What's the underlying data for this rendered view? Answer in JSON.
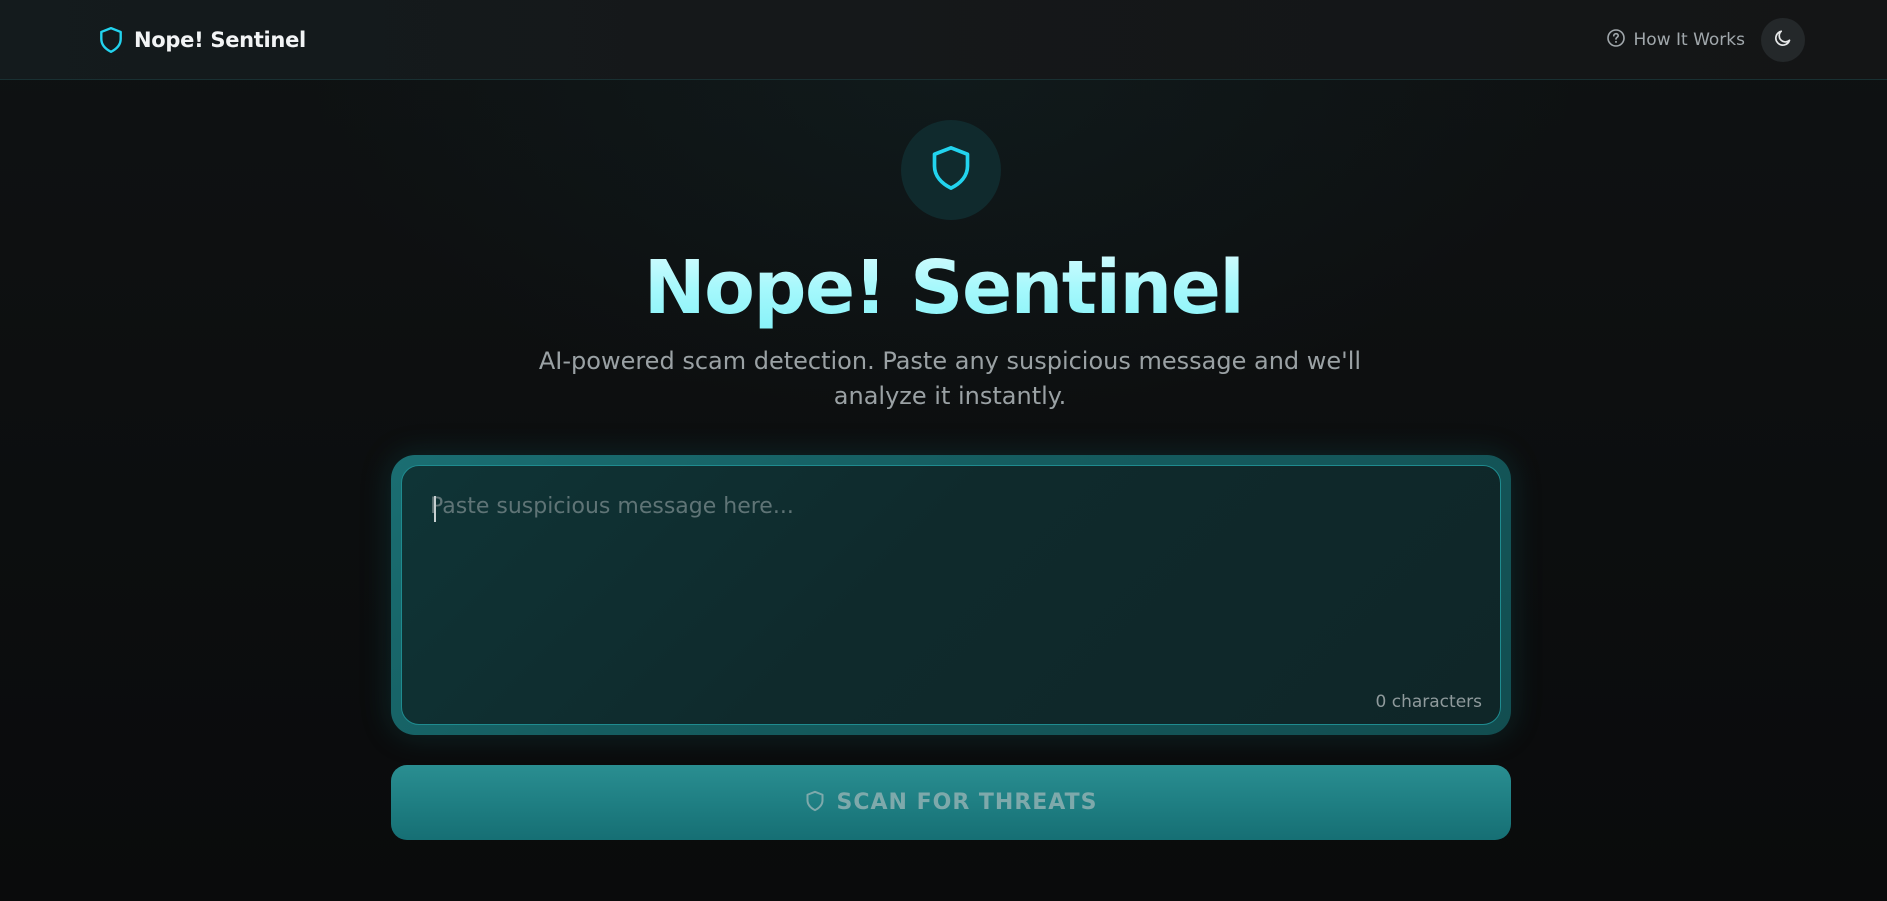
{
  "app": {
    "brand": "Nope! Sentinel"
  },
  "nav": {
    "how_it_works": "How It Works",
    "how_icon": "help-circle-icon",
    "theme_icon": "moon-icon"
  },
  "hero": {
    "icon": "shield-icon",
    "title": "Nope! Sentinel",
    "subtitle": "AI-powered scam detection. Paste any suspicious message and we'll analyze it instantly."
  },
  "input": {
    "value": "",
    "placeholder": "Paste suspicious message here...",
    "char_count": "0 characters"
  },
  "scan": {
    "label": "SCAN FOR THREATS",
    "icon": "shield-icon"
  },
  "colors": {
    "accent": "#22d3ee",
    "title_gradient_start": "#dcfcfe",
    "title_gradient_end": "#84f2f8",
    "button": "#1f7f83",
    "background": "#0b0c0d"
  }
}
